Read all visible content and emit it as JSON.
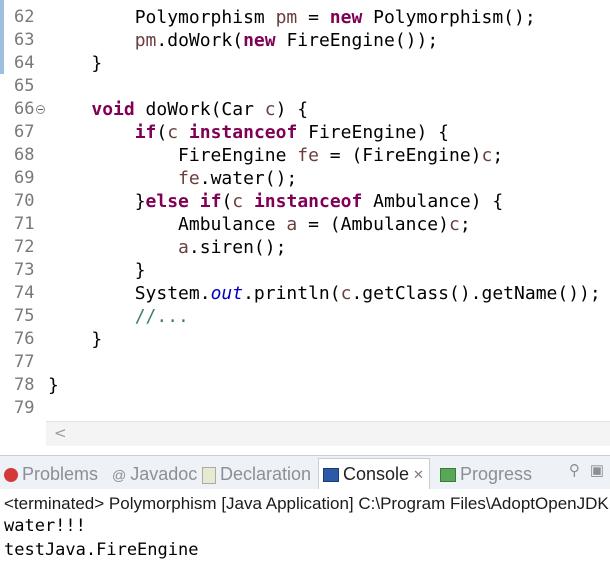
{
  "editor": {
    "lines": [
      {
        "num": "62",
        "tokens": [
          {
            "t": "        Polymorphism "
          },
          {
            "t": "pm",
            "c": "var"
          },
          {
            "t": " = "
          },
          {
            "t": "new",
            "c": "kw"
          },
          {
            "t": " Polymorphism();"
          }
        ]
      },
      {
        "num": "63",
        "tokens": [
          {
            "t": "        "
          },
          {
            "t": "pm",
            "c": "var"
          },
          {
            "t": ".doWork("
          },
          {
            "t": "new",
            "c": "kw"
          },
          {
            "t": " FireEngine());"
          }
        ]
      },
      {
        "num": "64",
        "tokens": [
          {
            "t": "    }"
          }
        ]
      },
      {
        "num": "65",
        "tokens": []
      },
      {
        "num": "66",
        "fold": true,
        "tokens": [
          {
            "t": "    "
          },
          {
            "t": "void",
            "c": "kw"
          },
          {
            "t": " doWork(Car "
          },
          {
            "t": "c",
            "c": "var"
          },
          {
            "t": ") {"
          }
        ]
      },
      {
        "num": "67",
        "tokens": [
          {
            "t": "        "
          },
          {
            "t": "if",
            "c": "kw"
          },
          {
            "t": "("
          },
          {
            "t": "c",
            "c": "var"
          },
          {
            "t": " "
          },
          {
            "t": "instanceof",
            "c": "kw"
          },
          {
            "t": " FireEngine) {"
          }
        ]
      },
      {
        "num": "68",
        "tokens": [
          {
            "t": "            FireEngine "
          },
          {
            "t": "fe",
            "c": "var"
          },
          {
            "t": " = (FireEngine)"
          },
          {
            "t": "c",
            "c": "var"
          },
          {
            "t": ";"
          }
        ]
      },
      {
        "num": "69",
        "tokens": [
          {
            "t": "            "
          },
          {
            "t": "fe",
            "c": "var"
          },
          {
            "t": ".water();"
          }
        ]
      },
      {
        "num": "70",
        "tokens": [
          {
            "t": "        }"
          },
          {
            "t": "else",
            "c": "kw"
          },
          {
            "t": " "
          },
          {
            "t": "if",
            "c": "kw"
          },
          {
            "t": "("
          },
          {
            "t": "c",
            "c": "var"
          },
          {
            "t": " "
          },
          {
            "t": "instanceof",
            "c": "kw"
          },
          {
            "t": " Ambulance) {"
          }
        ]
      },
      {
        "num": "71",
        "tokens": [
          {
            "t": "            Ambulance "
          },
          {
            "t": "a",
            "c": "var"
          },
          {
            "t": " = (Ambulance)"
          },
          {
            "t": "c",
            "c": "var"
          },
          {
            "t": ";"
          }
        ]
      },
      {
        "num": "72",
        "tokens": [
          {
            "t": "            "
          },
          {
            "t": "a",
            "c": "var"
          },
          {
            "t": ".siren();"
          }
        ]
      },
      {
        "num": "73",
        "tokens": [
          {
            "t": "        }"
          }
        ]
      },
      {
        "num": "74",
        "tokens": [
          {
            "t": "        System."
          },
          {
            "t": "out",
            "c": "fld"
          },
          {
            "t": ".println("
          },
          {
            "t": "c",
            "c": "var"
          },
          {
            "t": ".getClass().getName());"
          }
        ]
      },
      {
        "num": "75",
        "tokens": [
          {
            "t": "        //...",
            "c": "cmt"
          }
        ]
      },
      {
        "num": "76",
        "tokens": [
          {
            "t": "    }"
          }
        ]
      },
      {
        "num": "77",
        "tokens": []
      },
      {
        "num": "78",
        "tokens": [
          {
            "t": "}"
          }
        ]
      },
      {
        "num": "79",
        "tokens": []
      }
    ],
    "scroll_left_glyph": "<"
  },
  "panel": {
    "tabs": [
      {
        "label": "Problems",
        "icon": "problems-icon",
        "active": false
      },
      {
        "label": "Javadoc",
        "icon": "javadoc-icon",
        "active": false
      },
      {
        "label": "Declaration",
        "icon": "declaration-icon",
        "active": false
      },
      {
        "label": "Console",
        "icon": "console-icon",
        "active": true,
        "close": "✕"
      },
      {
        "label": "Progress",
        "icon": "progress-icon",
        "active": false
      }
    ],
    "tool_icons": [
      "pin-icon",
      "minimize-icon"
    ]
  },
  "console": {
    "status": "<terminated> Polymorphism [Java Application] C:\\Program Files\\AdoptOpenJDK",
    "output": [
      "water!!!",
      "testJava.FireEngine"
    ]
  },
  "colors": {
    "keyword": "#7f0055",
    "local_variable": "#6a3e3e",
    "static_field": "#0000c0",
    "comment": "#3f7f5f",
    "line_number": "#787878"
  }
}
